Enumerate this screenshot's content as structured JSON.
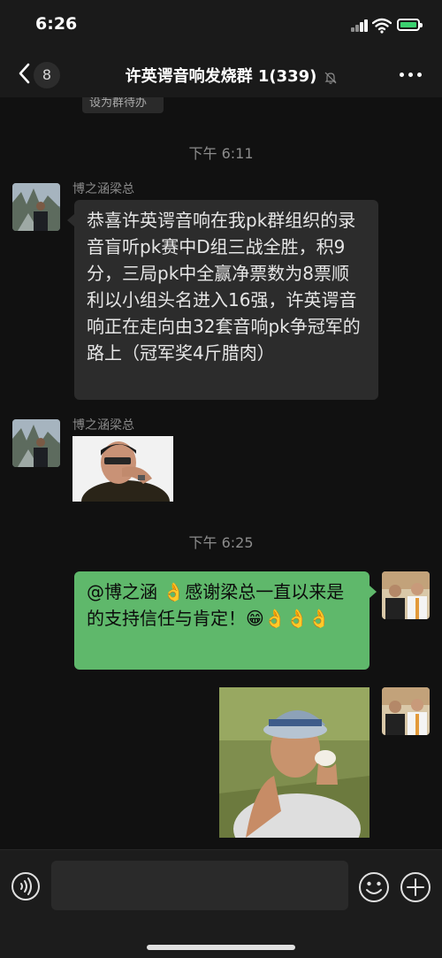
{
  "status": {
    "time": "6:26"
  },
  "header": {
    "badge_count": "8",
    "title": "许英谔音响发烧群 1(339)"
  },
  "chat": {
    "partial_label": "设为群待办",
    "messages": [
      {
        "timestamp": "下午 6:11"
      },
      {
        "sender": "博之涵梁总",
        "text": "恭喜许英谔音响在我pk群组织的录音盲听pk赛中D组三战全胜，积9分，三局pk中全赢净票数为8票顺利以小组头名进入16强，许英谔音响正在走向由32套音响pk争冠军的路上（冠军奖4斤腊肉）"
      },
      {
        "sender": "博之涵梁总",
        "sticker": "laughing-man-sticker"
      },
      {
        "timestamp": "下午 6:25"
      },
      {
        "text": "@博之涵 👌感谢梁总一直以来是的支持信任与肯定！😁👌👌👌"
      },
      {
        "sticker": "man-eating-sticker"
      }
    ]
  },
  "colors": {
    "background": "#111111",
    "bubble_left": "#2c2c2c",
    "bubble_right": "#5fb86b",
    "battery": "#3bd16f"
  },
  "icons": {
    "back": "chevron-left-icon",
    "mute": "mute-bell-icon",
    "more": "more-dots-icon",
    "voice": "voice-icon",
    "emoji": "emoji-icon",
    "plus": "plus-icon"
  }
}
